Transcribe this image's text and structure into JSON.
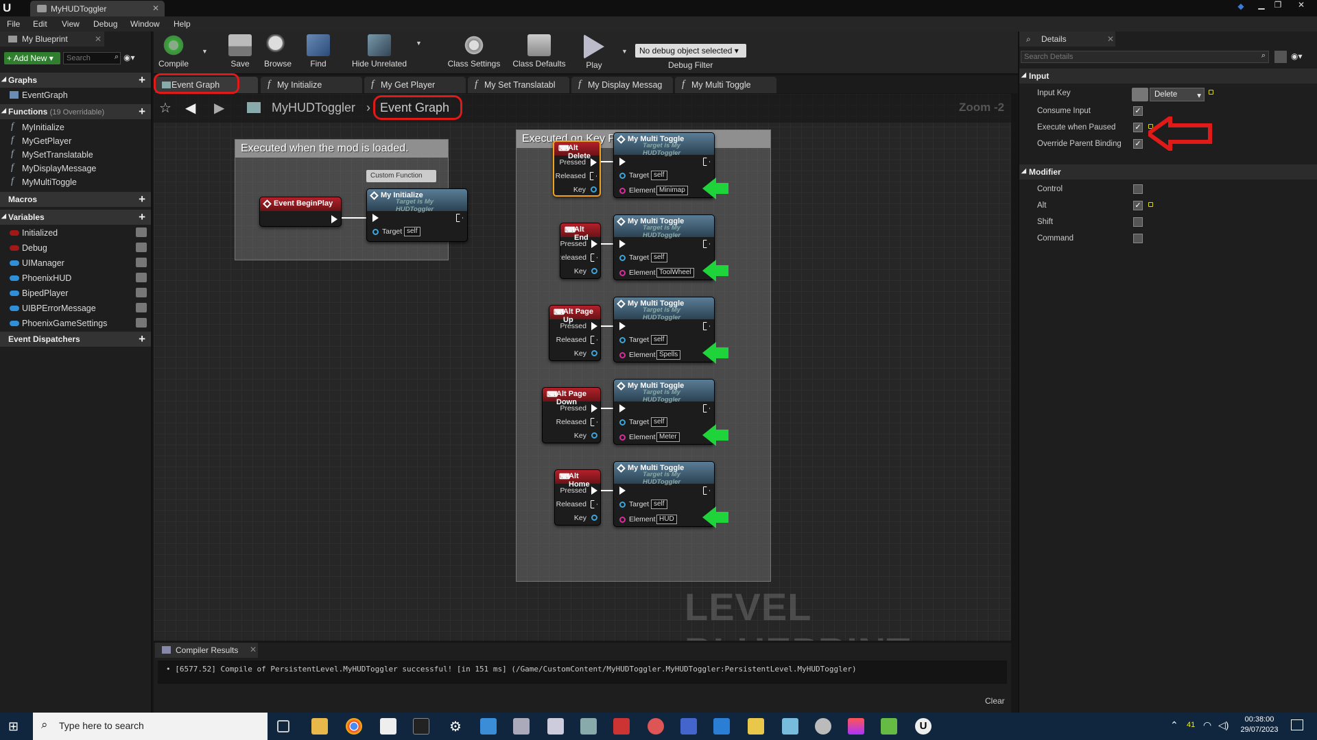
{
  "window": {
    "tab_title": "MyHUDToggler"
  },
  "menu": [
    "File",
    "Edit",
    "View",
    "Debug",
    "Window",
    "Help"
  ],
  "left_panel": {
    "tab": "My Blueprint",
    "add_new": "Add New",
    "search_placeholder": "Search",
    "graphs_label": "Graphs",
    "graphs": [
      "EventGraph"
    ],
    "functions_label": "Functions",
    "functions_count": "(19 Overridable)",
    "functions": [
      "MyInitialize",
      "MyGetPlayer",
      "MySetTranslatable",
      "MyDisplayMessage",
      "MyMultiToggle"
    ],
    "macros_label": "Macros",
    "variables_label": "Variables",
    "variables": [
      {
        "name": "Initialized",
        "color": "#a01818"
      },
      {
        "name": "Debug",
        "color": "#a01818"
      },
      {
        "name": "UIManager",
        "color": "#2f8fd8"
      },
      {
        "name": "PhoenixHUD",
        "color": "#2f8fd8"
      },
      {
        "name": "BipedPlayer",
        "color": "#2f8fd8"
      },
      {
        "name": "UIBPErrorMessage",
        "color": "#2f8fd8"
      },
      {
        "name": "PhoenixGameSettings",
        "color": "#2f8fd8"
      }
    ],
    "dispatchers_label": "Event Dispatchers"
  },
  "toolbar": {
    "compile": "Compile",
    "save": "Save",
    "browse": "Browse",
    "find": "Find",
    "hide_unrelated": "Hide Unrelated",
    "class_settings": "Class Settings",
    "class_defaults": "Class Defaults",
    "play": "Play",
    "debug_select": "No debug object selected",
    "debug_filter": "Debug Filter"
  },
  "doc_tabs": [
    "Event Graph",
    "My Initialize",
    "My Get Player",
    "My Set Translatabl",
    "My Display Messag",
    "My Multi Toggle"
  ],
  "breadcrumb": {
    "root": "MyHUDToggler",
    "current": "Event Graph",
    "zoom": "Zoom -2"
  },
  "graph": {
    "comment1": "Executed when the mod is loaded.",
    "comment2": "Executed on Key Press",
    "begin_play": "Event BeginPlay",
    "custom_function_tag": "Custom Function",
    "init_node": "My Initialize",
    "target_is": "Target is My HUDToggler",
    "target_lbl": "Target",
    "self_val": "self",
    "pressed": "Pressed",
    "released": "Released",
    "key": "Key",
    "element_lbl": "Element",
    "multi_toggle": "My Multi Toggle",
    "key_events": [
      {
        "name": "Alt Delete",
        "element": "Minimap"
      },
      {
        "name": "Alt End",
        "element": "ToolWheel"
      },
      {
        "name": "Alt Page Up",
        "element": "Spells"
      },
      {
        "name": "Alt Page Down",
        "element": "Meter"
      },
      {
        "name": "Alt Home",
        "element": "HUD"
      }
    ],
    "watermark": "LEVEL BLUEPRINT"
  },
  "compiler": {
    "tab": "Compiler Results",
    "message": "[6577.52] Compile of PersistentLevel.MyHUDToggler successful! [in 151 ms] (/Game/CustomContent/MyHUDToggler.MyHUDToggler:PersistentLevel.MyHUDToggler)",
    "clear": "Clear"
  },
  "details": {
    "tab": "Details",
    "search_placeholder": "Search Details",
    "input_section": "Input",
    "input_key_lbl": "Input Key",
    "input_key_val": "Delete",
    "consume_input": "Consume Input",
    "execute_paused": "Execute when Paused",
    "override_parent": "Override Parent Binding",
    "modifier_section": "Modifier",
    "control": "Control",
    "alt": "Alt",
    "shift": "Shift",
    "command": "Command"
  },
  "taskbar": {
    "search_placeholder": "Type here to search",
    "time": "00:38:00",
    "date": "29/07/2023",
    "temp": "41"
  }
}
